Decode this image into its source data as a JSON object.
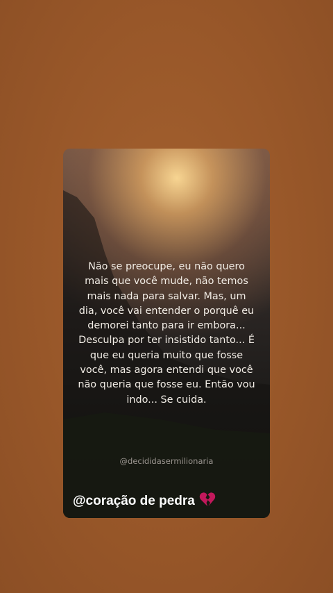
{
  "story": {
    "quote": "Não se preocupe, eu não quero mais que você mude, não temos mais nada para salvar. Mas, um dia, você vai entender o porquê eu demorei tanto para ir embora... Desculpa por ter insistido tanto... É que eu queria muito que fosse você, mas agora entendi que você não queria que fosse eu. Então vou indo... Se cuida.",
    "handle": "@decididasermilionaria",
    "signature": "@coração de pedra",
    "signature_icon": "broken-heart-icon"
  },
  "colors": {
    "background": "#985729",
    "quote_text": "#f2ede6",
    "heart": "#c2185b"
  }
}
